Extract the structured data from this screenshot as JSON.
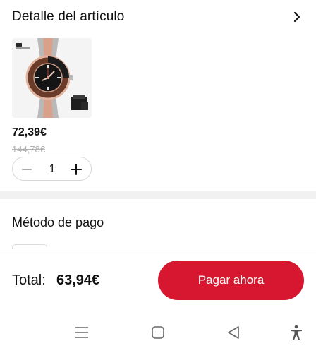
{
  "detail": {
    "title": "Detalle del artículo",
    "chevron_icon": "chevron-right-icon"
  },
  "product": {
    "image_icon": "wristwatch-product-photo",
    "price": "72,39€",
    "original_price": "144,78€",
    "quantity": "1"
  },
  "payment": {
    "title": "Método de pago"
  },
  "checkout": {
    "total_label": "Total:",
    "total_amount": "63,94€",
    "pay_label": "Pagar ahora",
    "accent_color": "#d7162f"
  },
  "nav": {
    "icons": [
      "menu-icon",
      "home-square-icon",
      "back-triangle-icon",
      "accessibility-icon"
    ]
  }
}
